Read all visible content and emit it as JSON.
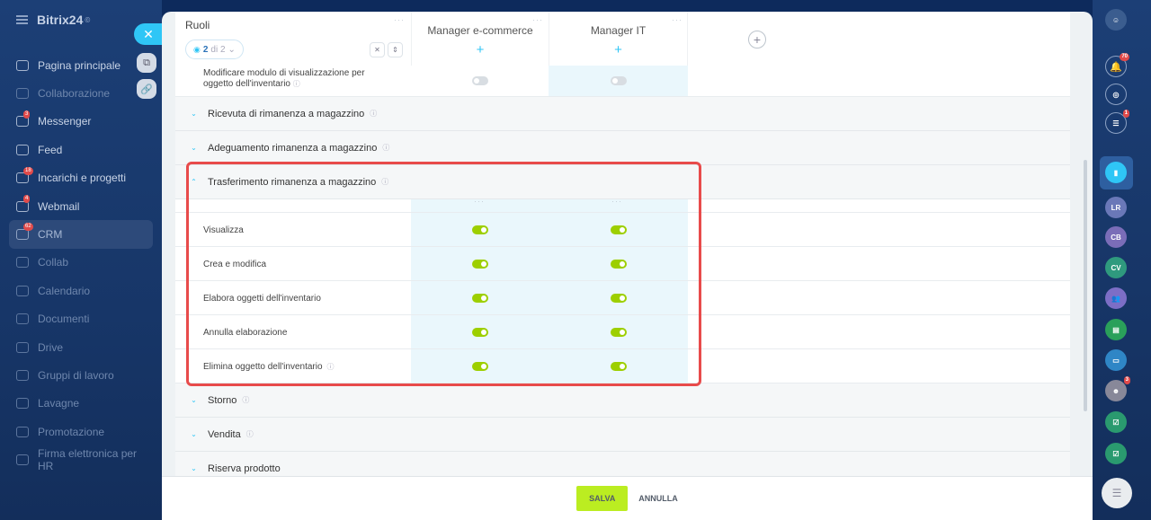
{
  "app": {
    "name": "Bitrix24",
    "logo_suffix": "©"
  },
  "sidebar": {
    "items": [
      {
        "label": "Pagina principale",
        "icon": "home-icon",
        "badge": ""
      },
      {
        "label": "Collaborazione",
        "icon": "collab-icon",
        "badge": ""
      },
      {
        "label": "Messenger",
        "icon": "chat-icon",
        "badge": "3"
      },
      {
        "label": "Feed",
        "icon": "feed-icon",
        "badge": ""
      },
      {
        "label": "Incarichi e progetti",
        "icon": "tasks-icon",
        "badge": "18"
      },
      {
        "label": "Webmail",
        "icon": "mail-icon",
        "badge": "4"
      },
      {
        "label": "CRM",
        "icon": "crm-icon",
        "badge": "62"
      },
      {
        "label": "Collab",
        "icon": "collab-circle-icon",
        "badge": ""
      },
      {
        "label": "Calendario",
        "icon": "calendar-icon",
        "badge": ""
      },
      {
        "label": "Documenti",
        "icon": "documents-icon",
        "badge": ""
      },
      {
        "label": "Drive",
        "icon": "drive-icon",
        "badge": ""
      },
      {
        "label": "Gruppi di lavoro",
        "icon": "groups-icon",
        "badge": ""
      },
      {
        "label": "Lavagne",
        "icon": "boards-icon",
        "badge": ""
      },
      {
        "label": "Promotazione",
        "icon": "promo-icon",
        "badge": ""
      },
      {
        "label": "Firma elettronica per HR",
        "icon": "sign-icon",
        "badge": ""
      }
    ]
  },
  "rightbar": {
    "notifications_badge": "70",
    "chat_badge": "1",
    "avatars": [
      "LR",
      "CB",
      "CV"
    ],
    "user_badge": "3"
  },
  "roles": {
    "header_title": "Ruoli",
    "pager_current": "2",
    "pager_text": "di 2",
    "columns": [
      "Manager e-commerce",
      "Manager IT"
    ]
  },
  "rows": {
    "top_row": "Modificare modulo di visualizzazione per oggetto dell'inventario",
    "sections": [
      "Ricevuta di rimanenza a magazzino",
      "Adeguamento rimanenza a magazzino",
      "Trasferimento rimanenza a magazzino",
      "Storno",
      "Vendita",
      "Riserva prodotto"
    ],
    "permissions": [
      {
        "label": "Visualizza",
        "col1": "on",
        "col2": "on"
      },
      {
        "label": "Crea e modifica",
        "col1": "on",
        "col2": "on"
      },
      {
        "label": "Elabora oggetti dell'inventario",
        "col1": "on",
        "col2": "on"
      },
      {
        "label": "Annulla elaborazione",
        "col1": "on",
        "col2": "on"
      },
      {
        "label": "Elimina oggetto dell'inventario",
        "col1": "on",
        "col2": "on"
      }
    ]
  },
  "footer": {
    "save": "SALVA",
    "cancel": "ANNULLA"
  },
  "colors": {
    "accent": "#2fc6f6",
    "toggle_on": "#9dcf00",
    "save_button": "#bbed21",
    "highlight": "#e84b4b"
  }
}
